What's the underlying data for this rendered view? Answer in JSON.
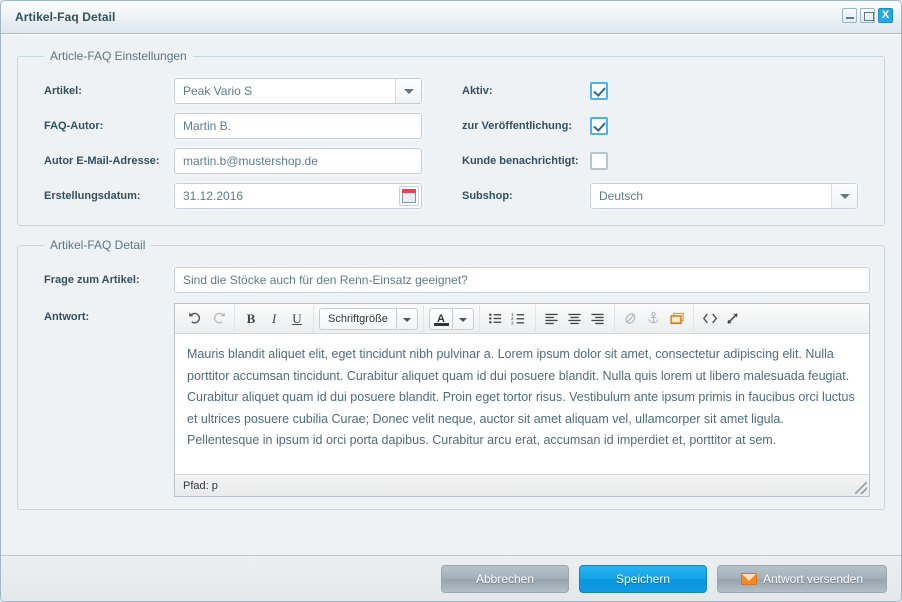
{
  "window": {
    "title": "Artikel-Faq Detail",
    "controls": {
      "minimize": "minimize-icon",
      "maximize": "maximize-icon",
      "close_label": "X"
    },
    "accent_blue": "#29a7e1",
    "border_color": "#9fb8c6",
    "background": "#eef2f5"
  },
  "settings_panel": {
    "legend": "Article-FAQ Einstellungen",
    "fields": {
      "artikel": {
        "label": "Artikel:",
        "value": "Peak Vario S",
        "type": "combobox"
      },
      "faq_autor": {
        "label": "FAQ-Autor:",
        "value": "Martin B.",
        "type": "text"
      },
      "autor_email": {
        "label": "Autor E-Mail-Adresse:",
        "value": "martin.b@mustershop.de",
        "type": "text"
      },
      "erstellungsdatum": {
        "label": "Erstellungsdatum:",
        "value": "31.12.2016",
        "type": "date"
      },
      "aktiv": {
        "label": "Aktiv:",
        "checked": true,
        "type": "checkbox"
      },
      "veroeffentlichung": {
        "label": "zur Veröffentlichung:",
        "checked": true,
        "type": "checkbox"
      },
      "kunde_benachrichtigt": {
        "label": "Kunde benachrichtigt:",
        "checked": false,
        "type": "checkbox"
      },
      "subshop": {
        "label": "Subshop:",
        "value": "Deutsch",
        "type": "combobox"
      }
    }
  },
  "detail_panel": {
    "legend": "Artikel-FAQ Detail",
    "question": {
      "label": "Frage zum Artikel:",
      "value": "Sind die Stöcke auch für den Renn-Einsatz geeignet?"
    },
    "answer": {
      "label": "Antwort:",
      "toolbar": {
        "undo": "undo-icon",
        "redo": "redo-icon",
        "bold": "B",
        "italic": "I",
        "underline": "U",
        "fontsize_label": "Schriftgröße",
        "fontsize_arrow": "chevron-down-icon",
        "forecolor": "A",
        "forecolor_arrow": "chevron-down-icon",
        "bullet_list": "bullet-list-icon",
        "numbered_list": "numbered-list-icon",
        "align_left": "align-left-icon",
        "align_center": "align-center-icon",
        "align_right": "align-right-icon",
        "unlink": "unlink-icon",
        "anchor": "anchor-icon",
        "image": "image-icon",
        "source_code": "source-code-icon",
        "fullscreen": "fullscreen-icon"
      },
      "content": "Mauris blandit aliquet elit, eget tincidunt nibh pulvinar a. Lorem ipsum dolor sit amet, consectetur adipiscing elit. Nulla porttitor accumsan tincidunt. Curabitur aliquet quam id dui posuere blandit. Nulla quis lorem ut libero malesuada feugiat. Curabitur aliquet quam id dui posuere blandit. Proin eget tortor risus. Vestibulum ante ipsum primis in faucibus orci luctus et ultrices posuere cubilia Curae; Donec velit neque, auctor sit amet aliquam vel, ullamcorper sit amet ligula. Pellentesque in ipsum id orci porta dapibus. Curabitur arcu erat, accumsan id imperdiet et, porttitor at sem.",
      "status": "Pfad: p"
    }
  },
  "footer": {
    "cancel_label": "Abbrechen",
    "save_label": "Speichern",
    "send_label": "Antwort versenden",
    "send_icon": "envelope-icon"
  }
}
